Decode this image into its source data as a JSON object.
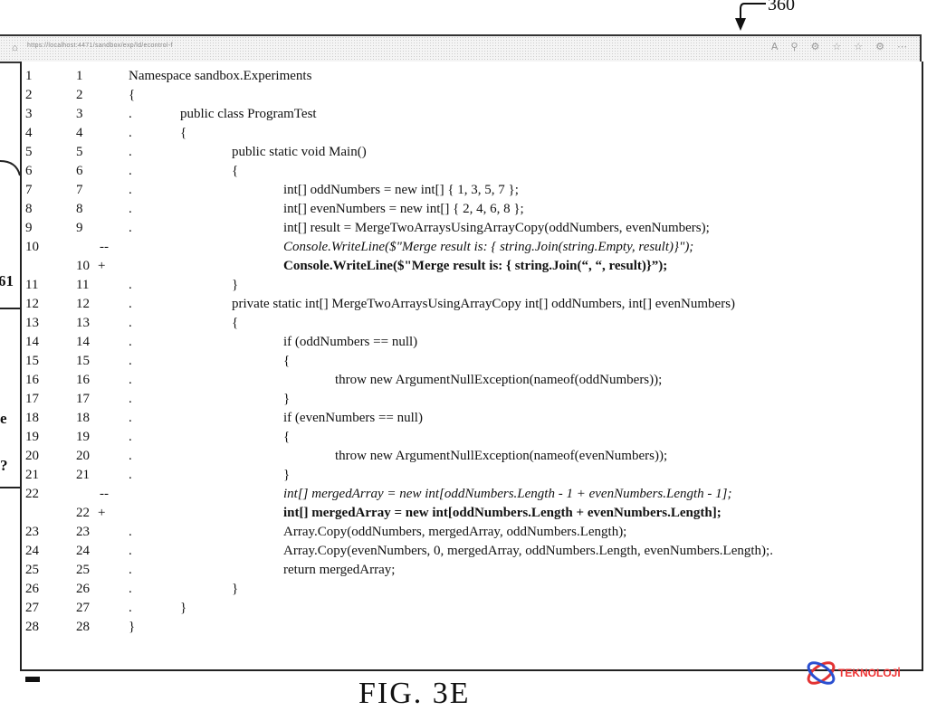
{
  "figure_ref": "360",
  "figure_caption": "FIG. 3E",
  "browser": {
    "url": "https://localhost:4471/sandbox/exp/ld/econtrol-f",
    "icons": [
      "home-icon",
      "read-aloud-icon",
      "zoom-icon",
      "extensions-icon",
      "favorite-icon",
      "collections-icon",
      "settings-icon",
      "more-icon"
    ]
  },
  "side_fragments": [
    "61",
    "e",
    "?"
  ],
  "logo_text": "TEKNOLOJİ",
  "colors": {
    "logo_red": "#e33333",
    "logo_blue": "#2a4fd0"
  },
  "diff": {
    "rows": [
      {
        "old": "1",
        "new": "1",
        "mark": "",
        "dot": "",
        "indent": 0,
        "type": "ctx",
        "code": "Namespace sandbox.Experiments"
      },
      {
        "old": "2",
        "new": "2",
        "mark": "",
        "dot": "",
        "indent": 0,
        "type": "ctx",
        "code": "{"
      },
      {
        "old": "3",
        "new": "3",
        "mark": "",
        "dot": ".",
        "indent": 1,
        "type": "ctx",
        "code": "public class ProgramTest"
      },
      {
        "old": "4",
        "new": "4",
        "mark": "",
        "dot": ".",
        "indent": 1,
        "type": "ctx",
        "code": "{"
      },
      {
        "old": "5",
        "new": "5",
        "mark": "",
        "dot": ".",
        "indent": 2,
        "type": "ctx",
        "code": "public static void Main()"
      },
      {
        "old": "6",
        "new": "6",
        "mark": "",
        "dot": ".",
        "indent": 2,
        "type": "ctx",
        "code": "{"
      },
      {
        "old": "7",
        "new": "7",
        "mark": "",
        "dot": ".",
        "indent": 3,
        "type": "ctx",
        "code": "int[] oddNumbers = new int[] { 1, 3, 5, 7 };"
      },
      {
        "old": "8",
        "new": "8",
        "mark": "",
        "dot": ".",
        "indent": 3,
        "type": "ctx",
        "code": "int[] evenNumbers = new int[] { 2, 4, 6, 8 };"
      },
      {
        "old": "9",
        "new": "9",
        "mark": "",
        "dot": ".",
        "indent": 3,
        "type": "ctx",
        "code": "int[] result = MergeTwoArraysUsingArrayCopy(oddNumbers, evenNumbers);"
      },
      {
        "old": "10",
        "new": "",
        "mark": "--",
        "dot": "",
        "indent": 3,
        "type": "del",
        "code": "Console.WriteLine($\"Merge result is: { string.Join(string.Empty, result)}\");"
      },
      {
        "old": "",
        "new": "10",
        "mark": "+",
        "dot": "",
        "indent": 3,
        "type": "add",
        "code": "Console.WriteLine($\"Merge result is: { string.Join(“, “, result)}”);"
      },
      {
        "old": "11",
        "new": "11",
        "mark": "",
        "dot": ".",
        "indent": 2,
        "type": "ctx",
        "code": "}"
      },
      {
        "old": "12",
        "new": "12",
        "mark": "",
        "dot": ".",
        "indent": 2,
        "type": "ctx",
        "code": "private static int[] MergeTwoArraysUsingArrayCopy int[] oddNumbers, int[] evenNumbers)"
      },
      {
        "old": "13",
        "new": "13",
        "mark": "",
        "dot": ".",
        "indent": 2,
        "type": "ctx",
        "code": "{"
      },
      {
        "old": "14",
        "new": "14",
        "mark": "",
        "dot": ".",
        "indent": 3,
        "type": "ctx",
        "code": "if (oddNumbers == null)"
      },
      {
        "old": "15",
        "new": "15",
        "mark": "",
        "dot": ".",
        "indent": 3,
        "type": "ctx",
        "code": "{"
      },
      {
        "old": "16",
        "new": "16",
        "mark": "",
        "dot": ".",
        "indent": 4,
        "type": "ctx",
        "code": "throw new ArgumentNullException(nameof(oddNumbers));"
      },
      {
        "old": "17",
        "new": "17",
        "mark": "",
        "dot": ".",
        "indent": 3,
        "type": "ctx",
        "code": "}"
      },
      {
        "old": "18",
        "new": "18",
        "mark": "",
        "dot": ".",
        "indent": 3,
        "type": "ctx",
        "code": "if (evenNumbers == null)"
      },
      {
        "old": "19",
        "new": "19",
        "mark": "",
        "dot": ".",
        "indent": 3,
        "type": "ctx",
        "code": "{"
      },
      {
        "old": "20",
        "new": "20",
        "mark": "",
        "dot": ".",
        "indent": 4,
        "type": "ctx",
        "code": "throw new ArgumentNullException(nameof(evenNumbers));"
      },
      {
        "old": "21",
        "new": "21",
        "mark": "",
        "dot": ".",
        "indent": 3,
        "type": "ctx",
        "code": "}"
      },
      {
        "old": "22",
        "new": "",
        "mark": "--",
        "dot": "",
        "indent": 3,
        "type": "del",
        "code": "int[] mergedArray = new int[oddNumbers.Length - 1 + evenNumbers.Length - 1];"
      },
      {
        "old": "",
        "new": "22",
        "mark": "+",
        "dot": "",
        "indent": 3,
        "type": "add",
        "code": "int[] mergedArray = new int[oddNumbers.Length + evenNumbers.Length];"
      },
      {
        "old": "23",
        "new": "23",
        "mark": "",
        "dot": ".",
        "indent": 3,
        "type": "ctx",
        "code": "Array.Copy(oddNumbers, mergedArray, oddNumbers.Length);"
      },
      {
        "old": "24",
        "new": "24",
        "mark": "",
        "dot": ".",
        "indent": 3,
        "type": "ctx",
        "code": "Array.Copy(evenNumbers, 0, mergedArray, oddNumbers.Length, evenNumbers.Length);."
      },
      {
        "old": "25",
        "new": "25",
        "mark": "",
        "dot": ".",
        "indent": 3,
        "type": "ctx",
        "code": "return mergedArray;"
      },
      {
        "old": "26",
        "new": "26",
        "mark": "",
        "dot": ".",
        "indent": 2,
        "type": "ctx",
        "code": "}"
      },
      {
        "old": "27",
        "new": "27",
        "mark": "",
        "dot": ".",
        "indent": 1,
        "type": "ctx",
        "code": "}"
      },
      {
        "old": "28",
        "new": "28",
        "mark": "",
        "dot": "",
        "indent": 0,
        "type": "ctx",
        "code": "}"
      }
    ]
  }
}
